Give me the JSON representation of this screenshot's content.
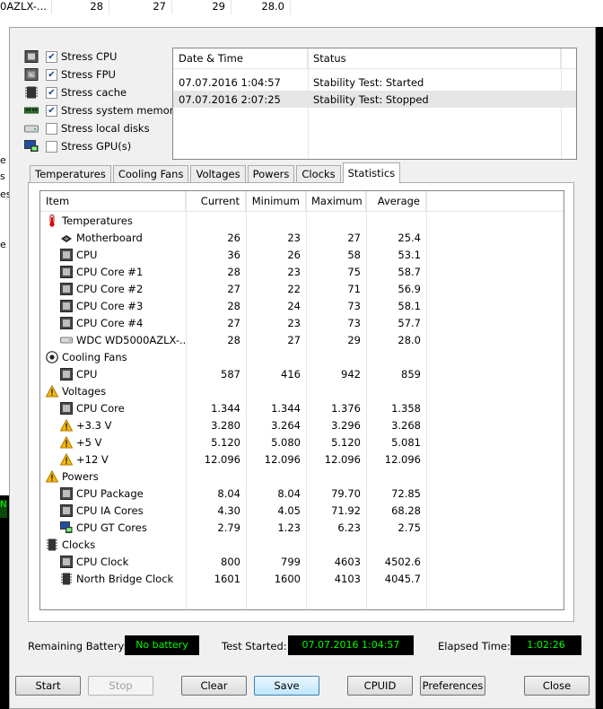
{
  "background": {
    "row": {
      "name": "0AZLX-...",
      "current": "28",
      "minimum": "27",
      "maximum": "29",
      "average": "28.0"
    },
    "left_fragments": [
      "e",
      "s",
      "es",
      "e"
    ],
    "left_status": "N"
  },
  "stress_options": [
    {
      "label": "Stress CPU",
      "checked": true,
      "icon": "cpu-chip-icon"
    },
    {
      "label": "Stress FPU",
      "checked": true,
      "icon": "fpu-chip-icon"
    },
    {
      "label": "Stress cache",
      "checked": true,
      "icon": "cache-chip-icon"
    },
    {
      "label": "Stress system memory",
      "checked": true,
      "icon": "memory-module-icon"
    },
    {
      "label": "Stress local disks",
      "checked": false,
      "icon": "disk-drive-icon"
    },
    {
      "label": "Stress GPU(s)",
      "checked": false,
      "icon": "gpu-monitor-icon"
    }
  ],
  "log": {
    "headers": [
      "Date & Time",
      "Status"
    ],
    "rows": [
      {
        "datetime": "07.07.2016 1:04:57",
        "status": "Stability Test: Started"
      },
      {
        "datetime": "07.07.2016 2:07:25",
        "status": "Stability Test: Stopped"
      }
    ]
  },
  "tabs": [
    "Temperatures",
    "Cooling Fans",
    "Voltages",
    "Powers",
    "Clocks",
    "Statistics"
  ],
  "active_tab": "Statistics",
  "stats": {
    "headers": {
      "item": "Item",
      "current": "Current",
      "minimum": "Minimum",
      "maximum": "Maximum",
      "average": "Average"
    },
    "rows": [
      {
        "type": "group",
        "name": "Temperatures",
        "icon": "thermometer-icon"
      },
      {
        "type": "item",
        "name": "Motherboard",
        "icon": "motherboard-icon",
        "current": "26",
        "minimum": "23",
        "maximum": "27",
        "average": "25.4"
      },
      {
        "type": "item",
        "name": "CPU",
        "icon": "cpu-chip-icon",
        "current": "36",
        "minimum": "26",
        "maximum": "58",
        "average": "53.1"
      },
      {
        "type": "item",
        "name": "CPU Core #1",
        "icon": "cpu-chip-icon",
        "current": "28",
        "minimum": "23",
        "maximum": "75",
        "average": "58.7"
      },
      {
        "type": "item",
        "name": "CPU Core #2",
        "icon": "cpu-chip-icon",
        "current": "27",
        "minimum": "22",
        "maximum": "71",
        "average": "56.9"
      },
      {
        "type": "item",
        "name": "CPU Core #3",
        "icon": "cpu-chip-icon",
        "current": "28",
        "minimum": "24",
        "maximum": "73",
        "average": "58.1"
      },
      {
        "type": "item",
        "name": "CPU Core #4",
        "icon": "cpu-chip-icon",
        "current": "27",
        "minimum": "23",
        "maximum": "73",
        "average": "57.7"
      },
      {
        "type": "item",
        "name": "WDC WD5000AZLX-...",
        "icon": "disk-drive-icon",
        "current": "28",
        "minimum": "27",
        "maximum": "29",
        "average": "28.0"
      },
      {
        "type": "group",
        "name": "Cooling Fans",
        "icon": "fan-icon"
      },
      {
        "type": "item",
        "name": "CPU",
        "icon": "cpu-chip-icon",
        "current": "587",
        "minimum": "416",
        "maximum": "942",
        "average": "859"
      },
      {
        "type": "group",
        "name": "Voltages",
        "icon": "warning-icon"
      },
      {
        "type": "item",
        "name": "CPU Core",
        "icon": "cpu-chip-icon",
        "current": "1.344",
        "minimum": "1.344",
        "maximum": "1.376",
        "average": "1.358"
      },
      {
        "type": "item",
        "name": "+3.3 V",
        "icon": "warning-icon",
        "current": "3.280",
        "minimum": "3.264",
        "maximum": "3.296",
        "average": "3.268"
      },
      {
        "type": "item",
        "name": "+5 V",
        "icon": "warning-icon",
        "current": "5.120",
        "minimum": "5.080",
        "maximum": "5.120",
        "average": "5.081"
      },
      {
        "type": "item",
        "name": "+12 V",
        "icon": "warning-icon",
        "current": "12.096",
        "minimum": "12.096",
        "maximum": "12.096",
        "average": "12.096"
      },
      {
        "type": "group",
        "name": "Powers",
        "icon": "warning-icon"
      },
      {
        "type": "item",
        "name": "CPU Package",
        "icon": "cpu-chip-icon",
        "current": "8.04",
        "minimum": "8.04",
        "maximum": "79.70",
        "average": "72.85"
      },
      {
        "type": "item",
        "name": "CPU IA Cores",
        "icon": "cpu-chip-icon",
        "current": "4.30",
        "minimum": "4.05",
        "maximum": "71.92",
        "average": "68.28"
      },
      {
        "type": "item",
        "name": "CPU GT Cores",
        "icon": "gpu-monitor-icon",
        "current": "2.79",
        "minimum": "1.23",
        "maximum": "6.23",
        "average": "2.75"
      },
      {
        "type": "group",
        "name": "Clocks",
        "icon": "memory-chip-icon"
      },
      {
        "type": "item",
        "name": "CPU Clock",
        "icon": "cpu-chip-icon",
        "current": "800",
        "minimum": "799",
        "maximum": "4603",
        "average": "4502.6"
      },
      {
        "type": "item",
        "name": "North Bridge Clock",
        "icon": "memory-chip-icon",
        "current": "1601",
        "minimum": "1600",
        "maximum": "4103",
        "average": "4045.7"
      }
    ]
  },
  "status": {
    "battery_label": "Remaining Battery:",
    "battery_value": "No battery",
    "started_label": "Test Started:",
    "started_value": "07.07.2016 1:04:57",
    "elapsed_label": "Elapsed Time:",
    "elapsed_value": "1:02:26",
    "value_color": "#00ff00"
  },
  "buttons": {
    "start": "Start",
    "stop": "Stop",
    "clear": "Clear",
    "save": "Save",
    "cpuid": "CPUID",
    "preferences": "Preferences",
    "close": "Close"
  }
}
